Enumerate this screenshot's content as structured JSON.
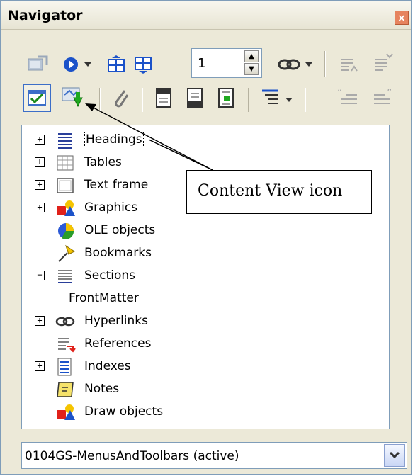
{
  "window": {
    "title": "Navigator",
    "close_label": "×"
  },
  "toolbar": {
    "page_number": "1",
    "row1_icons": [
      "toggle-icon",
      "navigation-icon",
      "dropdown-arrow-icon",
      "previous-icon",
      "next-icon",
      "page-spinner",
      "drag-mode-icon",
      "dropdown-arrow-icon",
      "promote-level-icon",
      "demote-level-icon"
    ],
    "row2_icons": [
      "content-view-icon",
      "list-box-icon",
      "reminder-icon",
      "header-icon",
      "footer-icon",
      "anchor-icon",
      "heading-levels-icon",
      "dropdown-arrow-icon",
      "promote-chapter-icon",
      "demote-chapter-icon"
    ]
  },
  "tree": {
    "items": [
      {
        "label": "Headings",
        "expander": "+",
        "icon": "headings-icon",
        "selected": true
      },
      {
        "label": "Tables",
        "expander": "+",
        "icon": "tables-icon"
      },
      {
        "label": "Text frame",
        "expander": "+",
        "icon": "text-frame-icon"
      },
      {
        "label": "Graphics",
        "expander": "+",
        "icon": "graphics-icon"
      },
      {
        "label": "OLE objects",
        "expander": "",
        "icon": "ole-objects-icon"
      },
      {
        "label": "Bookmarks",
        "expander": "",
        "icon": "bookmarks-icon"
      },
      {
        "label": "Sections",
        "expander": "−",
        "icon": "sections-icon"
      },
      {
        "label": "FrontMatter",
        "expander": "",
        "icon": ""
      },
      {
        "label": "Hyperlinks",
        "expander": "+",
        "icon": "hyperlinks-icon"
      },
      {
        "label": "References",
        "expander": "",
        "icon": "references-icon"
      },
      {
        "label": "Indexes",
        "expander": "+",
        "icon": "indexes-icon"
      },
      {
        "label": "Notes",
        "expander": "",
        "icon": "notes-icon"
      },
      {
        "label": "Draw objects",
        "expander": "",
        "icon": "draw-objects-icon"
      }
    ]
  },
  "callout": {
    "text": "Content View icon"
  },
  "document_select": {
    "value": "0104GS-MenusAndToolbars (active)"
  },
  "colors": {
    "window_bg": "#ece9d8",
    "border": "#7f9db9",
    "close": "#e6835e"
  }
}
